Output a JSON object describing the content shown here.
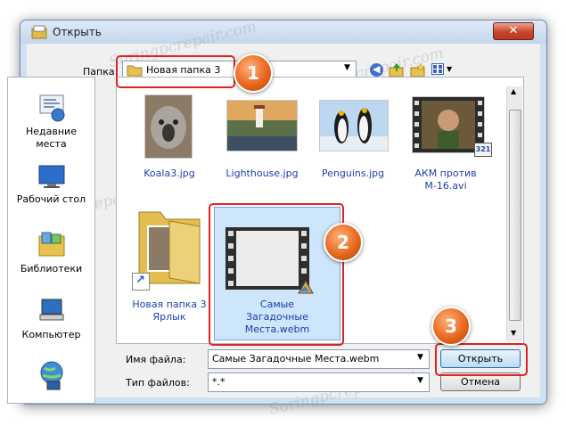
{
  "window": {
    "title": "Открыть",
    "close_glyph": "✕"
  },
  "toolbar": {
    "folder_label": "Папка:",
    "folder_value": "Новая папка 3"
  },
  "sidebar": {
    "items": [
      {
        "label_line1": "Недавние",
        "label_line2": "места",
        "icon": "recent-places-icon"
      },
      {
        "label_line1": "Рабочий стол",
        "label_line2": "",
        "icon": "desktop-icon"
      },
      {
        "label_line1": "Библиотеки",
        "label_line2": "",
        "icon": "libraries-icon"
      },
      {
        "label_line1": "Компьютер",
        "label_line2": "",
        "icon": "computer-icon"
      },
      {
        "label_line1": "",
        "label_line2": "",
        "icon": "network-icon"
      }
    ]
  },
  "files": [
    {
      "line1": "Koala3.jpg",
      "line2": "",
      "line3": ""
    },
    {
      "line1": "Lighthouse.jpg",
      "line2": "",
      "line3": ""
    },
    {
      "line1": "Penguins.jpg",
      "line2": "",
      "line3": ""
    },
    {
      "line1": "АКМ против",
      "line2": "M-16.avi",
      "line3": "",
      "badge": "321"
    },
    {
      "line1": "Новая папка 3",
      "line2": "Ярлык",
      "line3": ""
    },
    {
      "line1": "Самые",
      "line2": "Загадочные",
      "line3": "Места.webm"
    }
  ],
  "form": {
    "filename_label": "Имя файла:",
    "filename_value": "Самые Загадочные Места.webm",
    "filetype_label": "Тип файлов:",
    "filetype_value": "*.*"
  },
  "buttons": {
    "open": "Открыть",
    "cancel": "Отмена"
  },
  "badges": [
    "1",
    "2",
    "3"
  ],
  "watermark": "Soringpcrepair.com",
  "colors": {
    "accent_red": "#e12222",
    "badge_orange": "#e8681f",
    "link_blue": "#1c3fa8"
  }
}
